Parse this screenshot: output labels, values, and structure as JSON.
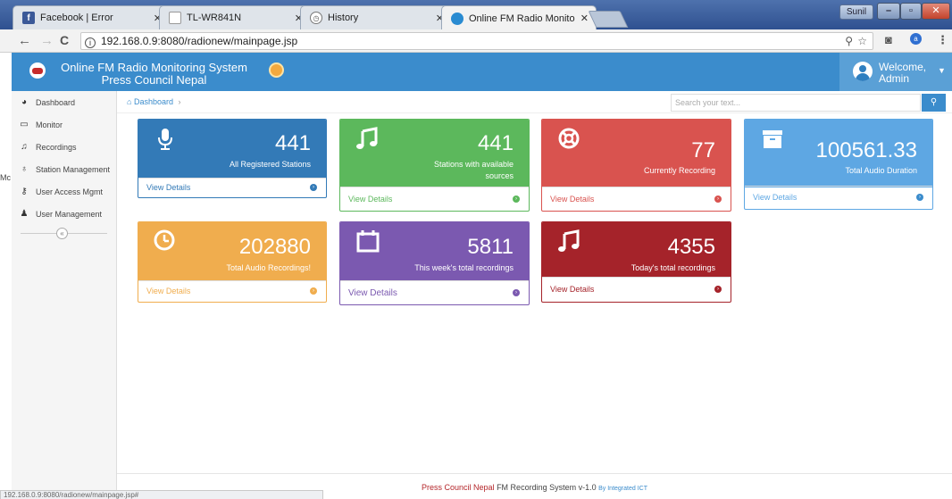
{
  "browser": {
    "tabs": [
      {
        "title": "Facebook | Error",
        "favicon": "facebook-icon",
        "color": "#3b5998"
      },
      {
        "title": "TL-WR841N",
        "favicon": "document-icon",
        "color": "#888888"
      },
      {
        "title": "History",
        "favicon": "history-icon",
        "color": "#777777"
      },
      {
        "title": "Online FM Radio Monito",
        "favicon": "globe-icon",
        "color": "#2a8bd1"
      }
    ],
    "profile_name": "Sunil",
    "url": "192.168.0.9:8080/radionew/mainpage.jsp",
    "status_url": "192.168.0.9:8080/radionew/mainpage.jsp#"
  },
  "header": {
    "title_line1": "Online FM Radio Monitoring System",
    "title_line2": "Press Council Nepal",
    "welcome_line1": "Welcome,",
    "welcome_line2": "Admin",
    "accent": "#3b8ccc"
  },
  "sidebar": {
    "items": [
      {
        "label": "Dashboard",
        "icon": "dashboard-icon"
      },
      {
        "label": "Monitor",
        "icon": "monitor-icon"
      },
      {
        "label": "Recordings",
        "icon": "music-icon"
      },
      {
        "label": "Station Management",
        "icon": "microphone-icon"
      },
      {
        "label": "User Access Mgmt",
        "icon": "key-icon"
      },
      {
        "label": "User Management",
        "icon": "users-icon"
      }
    ],
    "stray_text": "Mc"
  },
  "breadcrumb": {
    "item": "Dashboard"
  },
  "search": {
    "placeholder": "Search your text..."
  },
  "cards": [
    {
      "value": "441",
      "label": "All Registered Stations",
      "footer": "View Details",
      "icon": "microphone-icon",
      "color": "#337ab7"
    },
    {
      "value": "441",
      "label": "Stations with available sources",
      "footer": "View Details",
      "icon": "music-note-icon",
      "color": "#5cb85c"
    },
    {
      "value": "77",
      "label": "Currently Recording",
      "footer": "View Details",
      "icon": "life-ring-icon",
      "color": "#d9534f"
    },
    {
      "value": "100561.33",
      "label": "Total Audio Duration",
      "footer": "View Details",
      "icon": "archive-icon",
      "color": "#5ea7e3"
    },
    {
      "value": "202880",
      "label": "Total Audio Recordings!",
      "footer": "View Details",
      "icon": "clock-icon",
      "color": "#f0ad4e"
    },
    {
      "value": "5811",
      "label": "This week's total recordings",
      "footer": "View Details",
      "icon": "calendar-icon",
      "color": "#7b59b0"
    },
    {
      "value": "4355",
      "label": "Today's total recordings",
      "footer": "View Details",
      "icon": "music-note-icon",
      "color": "#a5232a"
    }
  ],
  "footer": {
    "brand": "Press Council Nepal",
    "text": "FM Recording System v-1.0",
    "by": "By Integrated ICT"
  }
}
